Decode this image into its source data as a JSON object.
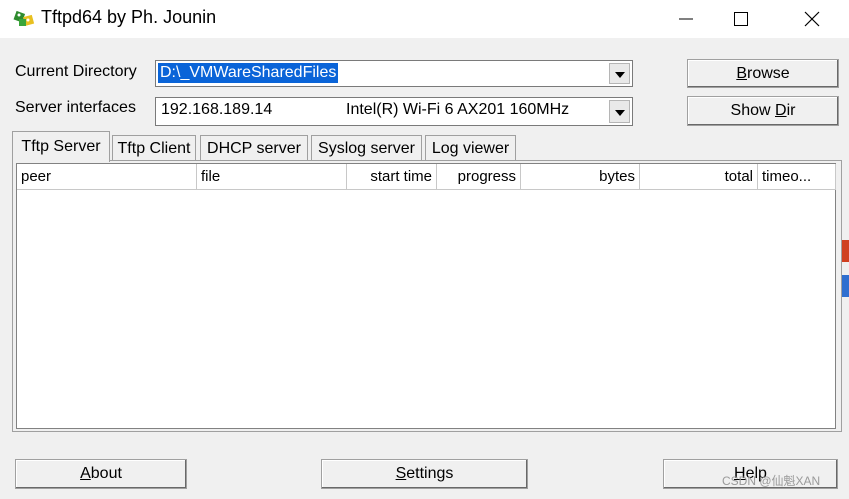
{
  "window": {
    "title": "Tftpd64 by Ph. Jounin",
    "app_icon": "tftpd-app-icon",
    "minimize_icon": "minimize-icon",
    "maximize_icon": "maximize-icon",
    "close_icon": "close-icon"
  },
  "directory": {
    "label": "Current Directory",
    "value": "D:\\_VMWareSharedFiles"
  },
  "interfaces": {
    "label": "Server interfaces",
    "ip": "192.168.189.14",
    "adapter": "Intel(R) Wi-Fi 6 AX201 160MHz"
  },
  "buttons": {
    "browse_pre": "",
    "browse_ul": "B",
    "browse_post": "rowse",
    "showdir_pre": "Show ",
    "showdir_ul": "D",
    "showdir_post": "ir",
    "about_pre": "",
    "about_ul": "A",
    "about_post": "bout",
    "settings_pre": "",
    "settings_ul": "S",
    "settings_post": "ettings",
    "help_pre": "",
    "help_ul": "H",
    "help_post": "elp"
  },
  "tabs": [
    {
      "label": "Tftp Server",
      "active": true
    },
    {
      "label": "Tftp Client",
      "active": false
    },
    {
      "label": "DHCP server",
      "active": false
    },
    {
      "label": "Syslog server",
      "active": false
    },
    {
      "label": "Log viewer",
      "active": false
    }
  ],
  "table": {
    "columns": [
      "peer",
      "file",
      "start time",
      "progress",
      "bytes",
      "total",
      "timeo..."
    ],
    "rows": []
  },
  "watermark": "CSDN @仙魁XAN",
  "colors": {
    "selection": "#0a64d8",
    "app_icon_green": "#2e8b2e",
    "app_icon_yellow": "#e8c020"
  }
}
